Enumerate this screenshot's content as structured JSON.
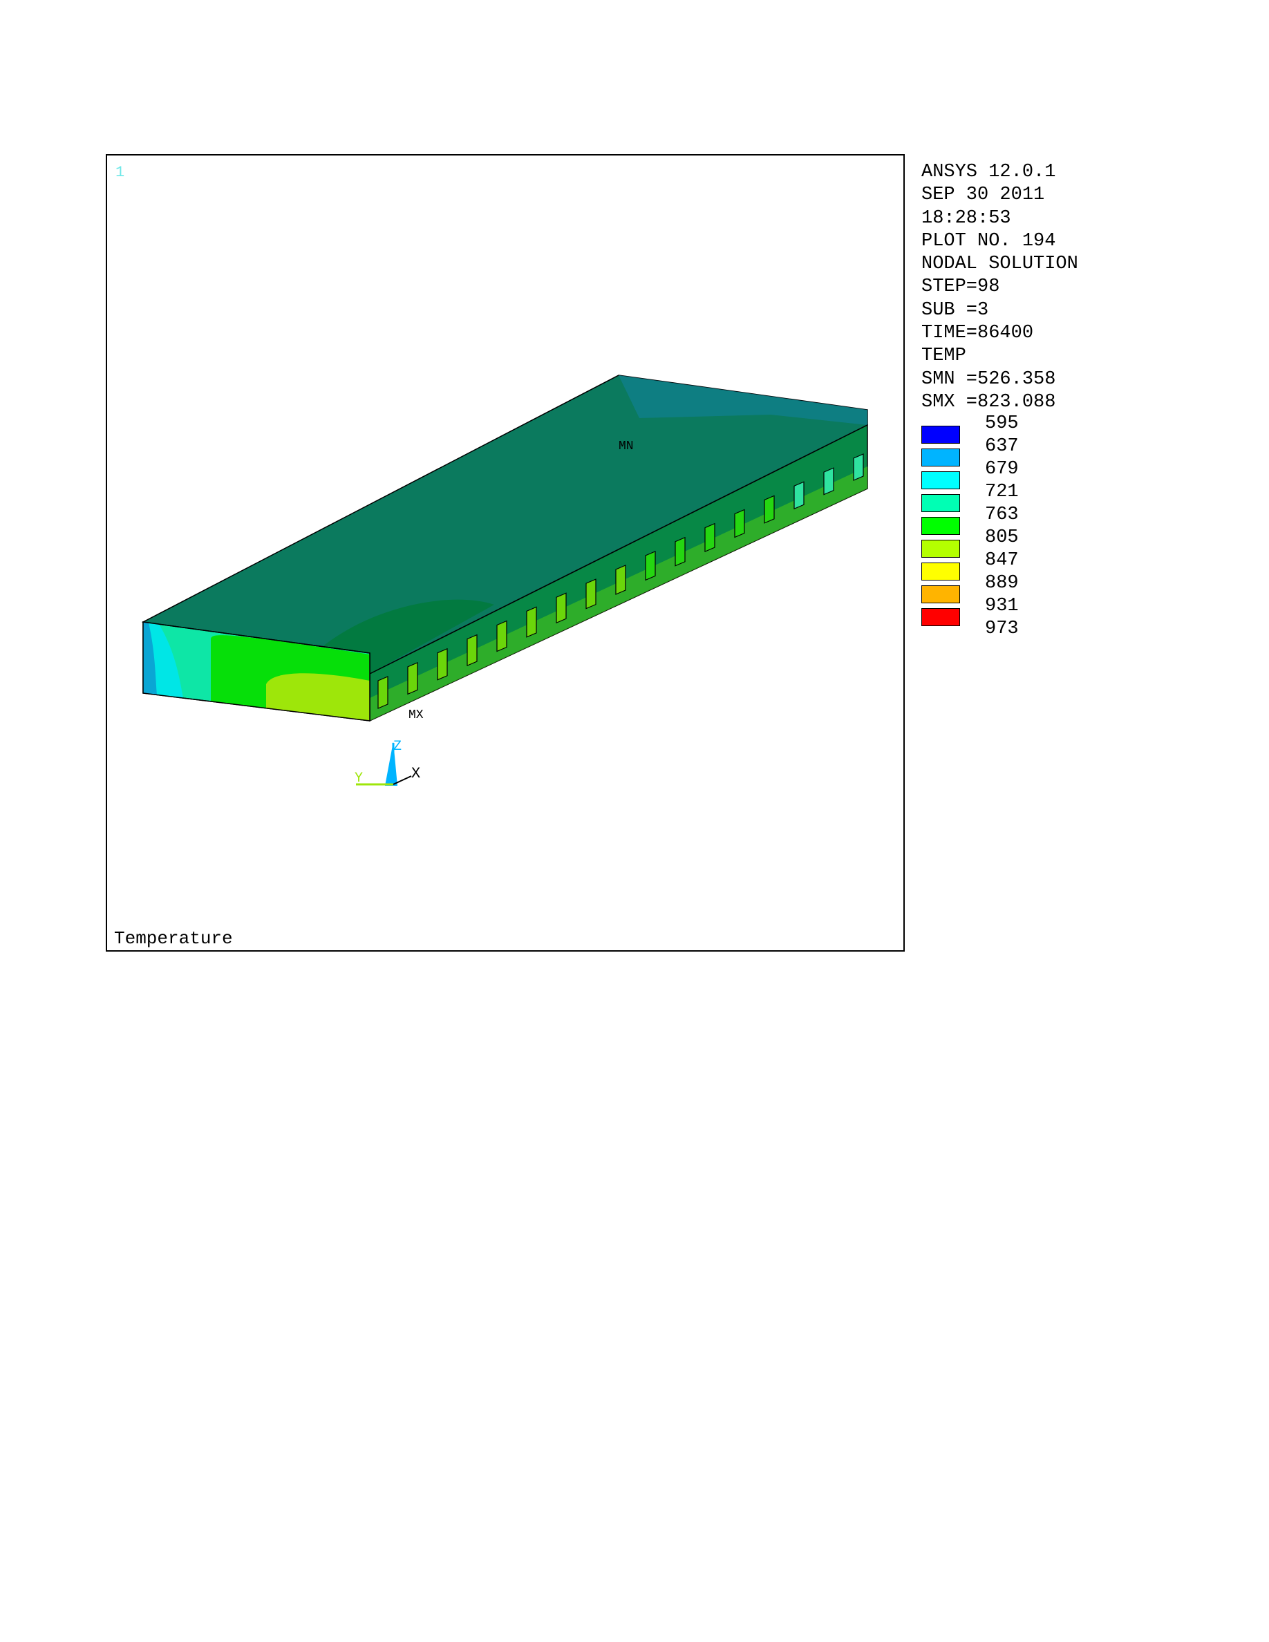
{
  "window_number": "1",
  "plot_title": "Temperature",
  "info_lines": [
    "ANSYS 12.0.1",
    "SEP 30 2011",
    "18:28:53",
    "PLOT NO. 194",
    "NODAL SOLUTION",
    "STEP=98",
    "SUB =3",
    "TIME=86400",
    "TEMP",
    "SMN =526.358",
    "SMX =823.088"
  ],
  "legend": {
    "values": [
      "595",
      "637",
      "679",
      "721",
      "763",
      "805",
      "847",
      "889",
      "931",
      "973"
    ],
    "colors": [
      "#0000ff",
      "#00b4ff",
      "#00ffff",
      "#00ffb4",
      "#00ff00",
      "#b4ff00",
      "#ffff00",
      "#ffb400",
      "#ff0000"
    ]
  },
  "model_labels": {
    "min": "MN",
    "max": "MX"
  },
  "triad": {
    "z": "Z",
    "y": "Y",
    "x": "X"
  },
  "colors": {
    "top_face": "#0b7a5e",
    "top_corner": "#0f7f88",
    "top_mid": "#017a3d",
    "front_light": "#0ee6a6",
    "front_green": "#06df09",
    "front_yellowgreen": "#9ee60a",
    "front_cyan": "#00e6e6",
    "front_blue": "#0aa6d4",
    "side_face": "#078846",
    "tooth": "#6bd60a"
  }
}
